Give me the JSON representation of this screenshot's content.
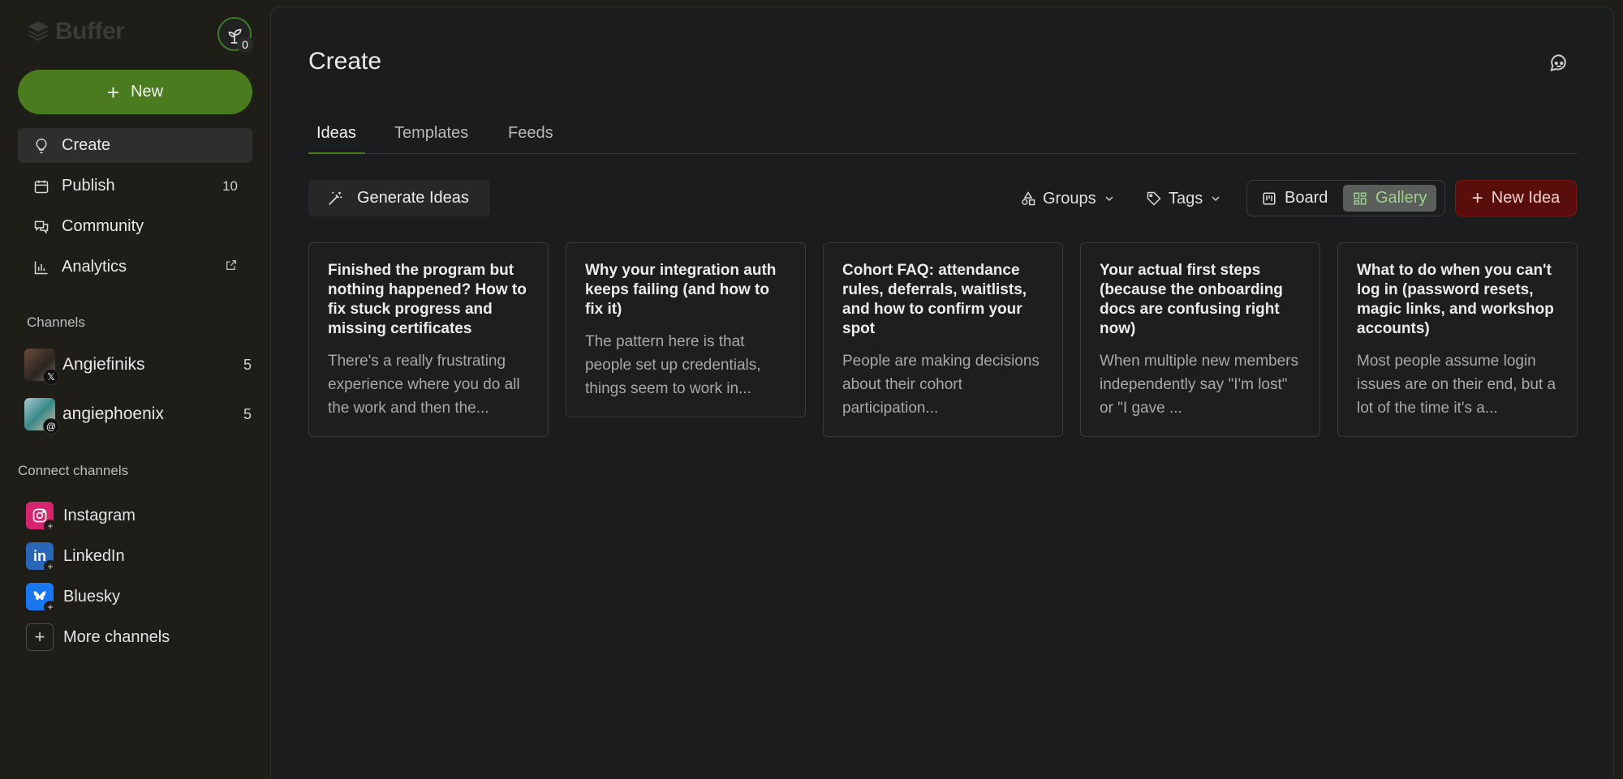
{
  "sidebar": {
    "logo": "Buffer",
    "plant_count": "0",
    "new_label": "New",
    "nav": [
      {
        "label": "Create",
        "count": ""
      },
      {
        "label": "Publish",
        "count": "10"
      },
      {
        "label": "Community",
        "count": ""
      },
      {
        "label": "Analytics",
        "count": ""
      }
    ],
    "channels_label": "Channels",
    "channels": [
      {
        "name": "Angiefiniks",
        "count": "5",
        "network": "x-icon"
      },
      {
        "name": "angiephoenix",
        "count": "5",
        "network": "threads-icon"
      }
    ],
    "connect_label": "Connect channels",
    "connect": [
      {
        "name": "Instagram",
        "color": "#d6246e"
      },
      {
        "name": "LinkedIn",
        "color": "#2a66b8"
      },
      {
        "name": "Bluesky",
        "color": "#1a77f0"
      },
      {
        "name": "More channels",
        "color": ""
      }
    ]
  },
  "main": {
    "title": "Create",
    "tabs": [
      "Ideas",
      "Templates",
      "Feeds"
    ],
    "generate_label": "Generate Ideas",
    "groups_label": "Groups",
    "tags_label": "Tags",
    "board_label": "Board",
    "gallery_label": "Gallery",
    "new_idea_label": "New Idea",
    "cards": [
      {
        "title": "Finished the program but nothing happened? How to fix stuck progress and missing certificates",
        "body": "There's a really frustrating experience where you do all the work and then the..."
      },
      {
        "title": "Why your integration auth keeps failing (and how to fix it)",
        "body": "The pattern here is that people set up credentials, things seem to work in..."
      },
      {
        "title": "Cohort FAQ: attendance rules, deferrals, waitlists, and how to confirm your spot",
        "body": "People are making decisions about their cohort participation..."
      },
      {
        "title": "Your actual first steps (because the onboarding docs are confusing right now)",
        "body": "When multiple new members independently say \"I'm lost\" or \"I gave ..."
      },
      {
        "title": "What to do when you can't log in (password resets, magic links, and workshop accounts)",
        "body": "Most people assume login issues are on their end, but a lot of the time it's a..."
      }
    ]
  },
  "colors": {
    "accent_green": "#4a7b1f",
    "new_idea_red": "#5a0e0c",
    "gallery_text": "#9fcf8a"
  }
}
